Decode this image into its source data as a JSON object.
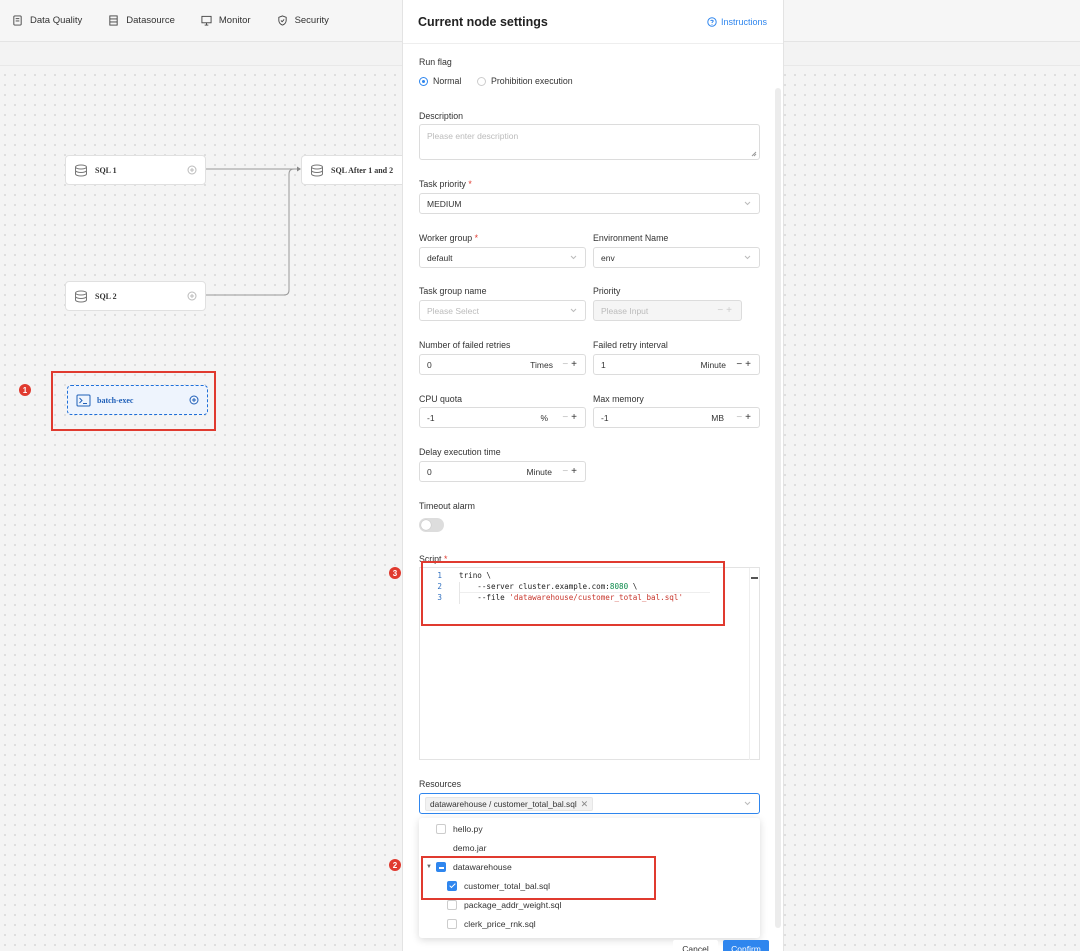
{
  "nav": {
    "items": [
      {
        "label": "Data Quality",
        "icon": "data-quality-icon"
      },
      {
        "label": "Datasource",
        "icon": "datasource-icon"
      },
      {
        "label": "Monitor",
        "icon": "monitor-icon"
      },
      {
        "label": "Security",
        "icon": "security-icon"
      }
    ]
  },
  "canvas": {
    "nodes": {
      "sql1": "SQL 1",
      "sql_after": "SQL After 1 and 2",
      "sql2": "SQL 2",
      "batch": "batch-exec"
    },
    "annotations": [
      "1",
      "2",
      "3"
    ],
    "annotation_color": "#e03a2f"
  },
  "drawer": {
    "title": "Current node settings",
    "instructions": "Instructions",
    "run_flag": {
      "label": "Run flag",
      "options": [
        "Normal",
        "Prohibition execution"
      ],
      "selected": "Normal"
    },
    "description": {
      "label": "Description",
      "placeholder": "Please enter description"
    },
    "task_priority": {
      "label": "Task priority",
      "value": "MEDIUM"
    },
    "worker_group": {
      "label": "Worker group",
      "value": "default"
    },
    "environment": {
      "label": "Environment Name",
      "value": "env"
    },
    "task_group": {
      "label": "Task group name",
      "placeholder": "Please Select"
    },
    "priority": {
      "label": "Priority",
      "placeholder": "Please Input"
    },
    "failed_retries": {
      "label": "Number of failed retries",
      "value": "0",
      "unit": "Times"
    },
    "retry_interval": {
      "label": "Failed retry interval",
      "value": "1",
      "unit": "Minute"
    },
    "cpu_quota": {
      "label": "CPU quota",
      "value": "-1",
      "unit": "%"
    },
    "max_memory": {
      "label": "Max memory",
      "value": "-1",
      "unit": "MB"
    },
    "delay_time": {
      "label": "Delay execution time",
      "value": "0",
      "unit": "Minute"
    },
    "timeout_alarm": {
      "label": "Timeout alarm",
      "enabled": false
    },
    "script": {
      "label": "Script",
      "lines": [
        {
          "num": "1",
          "text": "trino \\"
        },
        {
          "num": "2",
          "pre": "    --server cluster.example.com:",
          "num_val": "8080",
          "post": " \\"
        },
        {
          "num": "3",
          "pre": "    --file ",
          "str_val": "'datawarehouse/customer_total_bal.sql'"
        }
      ]
    },
    "resources": {
      "label": "Resources",
      "selected_tag": "datawarehouse / customer_total_bal.sql",
      "tree": [
        {
          "label": "hello.py",
          "checked": false
        },
        {
          "label": "demo.jar",
          "checked": false
        },
        {
          "label": "datawarehouse",
          "state": "partial"
        },
        {
          "label": "customer_total_bal.sql",
          "checked": true
        },
        {
          "label": "package_addr_weight.sql",
          "checked": false
        },
        {
          "label": "clerk_price_rnk.sql",
          "checked": false
        }
      ]
    },
    "buttons": {
      "cancel": "Cancel",
      "confirm": "Confirm"
    }
  },
  "accent_color": "#2f86ee"
}
